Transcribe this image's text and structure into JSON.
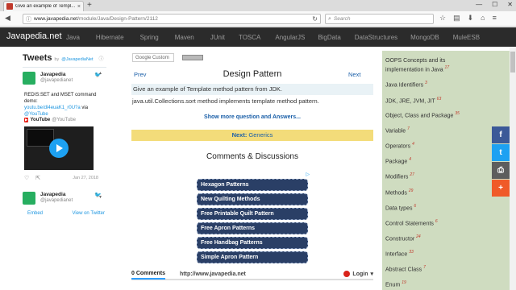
{
  "browser": {
    "tab_title": "Give an example of Templ...",
    "tab_close": "×",
    "new_tab": "+",
    "win_min": "—",
    "win_max": "☐",
    "win_close": "✕",
    "url_host": "www.javapedia.net",
    "url_path": "/module/Java/Design-Pattern/2112",
    "search_placeholder": "Search"
  },
  "site": {
    "logo": "Javapedia.net",
    "menu": [
      "Java",
      "Hibernate",
      "Spring",
      "Maven",
      "JUnit",
      "TOSCA",
      "AngularJS",
      "BigData",
      "DataStructures",
      "MongoDB",
      "MuleESB"
    ]
  },
  "tweets": {
    "title": "Tweets",
    "by_label": "by",
    "by_handle": "@JavapediaNet",
    "info_icon": "ⓘ",
    "tweet1": {
      "name": "Javapedia",
      "handle": "@javapedianet",
      "text": "REDIS:SET and MSET command demo:",
      "link": "youtu.be/dl4euaK1_r0U?a",
      "via": "via",
      "mention": "@YouTube",
      "yt_label": "YouTube",
      "yt_handle": "@YouTube",
      "date": "Jan 27, 2018"
    },
    "tweet2": {
      "name": "Javapedia",
      "handle": "@javapedianet"
    },
    "embed": "Embed",
    "view_on": "View on Twitter"
  },
  "main": {
    "gcs_label": "Google Custom",
    "title": "Design Pattern",
    "prev": "Prev",
    "next": "Next",
    "question": "Give an example of Template method pattern from JDK.",
    "answer": "java.util.Collections.sort method implements template method pattern.",
    "show_more": "Show more question and Answers...",
    "next_label": "Next:",
    "next_topic": "Generics",
    "comments_title": "Comments & Discussions",
    "ad_mark": "▷",
    "ads": [
      "Hexagon Patterns",
      "New Quilting Methods",
      "Free Printable Quilt Pattern",
      "Free Apron Patterns",
      "Free Handbag Patterns",
      "Simple Apron Pattern"
    ],
    "disqus": {
      "count": "0 Comments",
      "site": "http://www.javapedia.net",
      "login": "Login",
      "login_caret": "▾"
    }
  },
  "sidebar": {
    "items": [
      {
        "label": "OOPS Concepts and its implementation in Java",
        "count": "17"
      },
      {
        "label": "Java Identifiers",
        "count": "3"
      },
      {
        "label": "JDK, JRE, JVM, JIT",
        "count": "63"
      },
      {
        "label": "Object, Class and Package",
        "count": "35"
      },
      {
        "label": "Variable",
        "count": "7"
      },
      {
        "label": "Operators",
        "count": "4"
      },
      {
        "label": "Package",
        "count": "4"
      },
      {
        "label": "Modifiers",
        "count": "27"
      },
      {
        "label": "Methods",
        "count": "29"
      },
      {
        "label": "Data types",
        "count": "6"
      },
      {
        "label": "Control Statements",
        "count": "6"
      },
      {
        "label": "Constructor",
        "count": "24"
      },
      {
        "label": "Interface",
        "count": "33"
      },
      {
        "label": "Abstract Class",
        "count": "7"
      },
      {
        "label": "Enum",
        "count": "19"
      }
    ]
  },
  "social": {
    "facebook": "f",
    "twitter": "t",
    "print": "⎙",
    "more": "+",
    "colors": {
      "facebook": "#3b5998",
      "twitter": "#1da1f2",
      "print": "#5d5d5d",
      "more": "#f05a28"
    }
  }
}
